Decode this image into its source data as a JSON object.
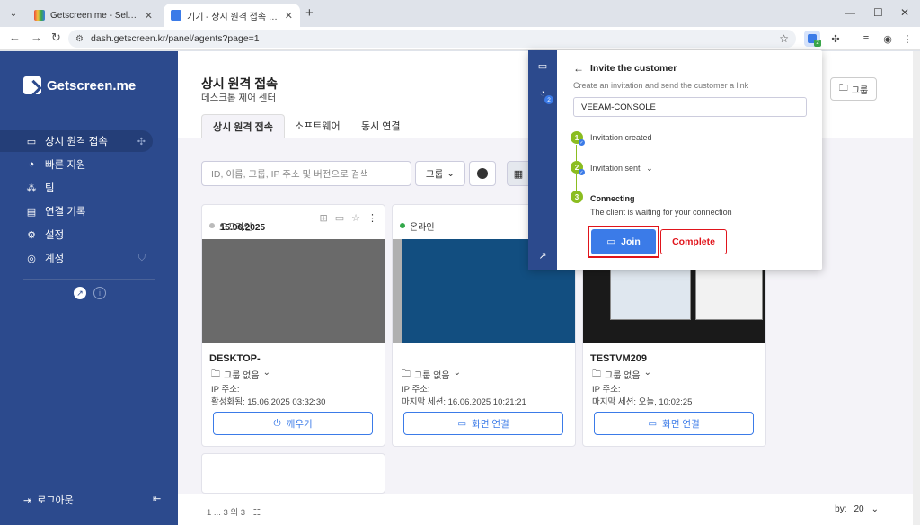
{
  "browser": {
    "tabs": [
      {
        "title": "Getscreen.me - Self-Hosted - G",
        "active": false
      },
      {
        "title": "기기 - 상시 원격 접속 - Getscre",
        "active": true
      }
    ],
    "new_tab": "+",
    "url": "dash.getscreen.kr/panel/agents?page=1"
  },
  "sidebar": {
    "logo_text": "Getscreen.me",
    "items": [
      {
        "label": "상시 원격 접속",
        "icon": "devices-icon"
      },
      {
        "label": "빠른 지원",
        "icon": "speedometer-icon"
      },
      {
        "label": "팀",
        "icon": "team-icon"
      },
      {
        "label": "연결 기록",
        "icon": "calendar-icon"
      },
      {
        "label": "설정",
        "icon": "gear-icon"
      },
      {
        "label": "계정",
        "icon": "account-icon"
      }
    ],
    "logout": "로그아웃"
  },
  "main": {
    "title": "상시 원격 접속",
    "subtitle": "데스크톱 제어 센터",
    "tabs": [
      "상시 원격 접속",
      "소프트웨어",
      "동시 연결"
    ],
    "group_button": "그룹",
    "search_placeholder": "ID, 이름, 그룹, IP 주소 및 버전으로 검색",
    "group_dropdown": "그룹"
  },
  "cards": [
    {
      "status": "오프라인",
      "status_color": "#bbbbbb",
      "date": "15.06.2025",
      "name": "DESKTOP-",
      "group": "그룹 없음",
      "ip_label": "IP 주소:",
      "line2": "활성화됨: 15.06.2025 03:32:30",
      "button": "깨우기",
      "button_icon": "power-icon"
    },
    {
      "status": "온라인",
      "status_color": "#33a84a",
      "date": "",
      "name": "",
      "group": "그룹 없음",
      "ip_label": "IP 주소:",
      "line2": "마지막 세션: 16.06.2025 10:21:21",
      "button": "화면 연결",
      "button_icon": "screen-icon"
    },
    {
      "status": "",
      "status_color": "#33a84a",
      "date": "",
      "name": "TESTVM209",
      "group": "그룹 없음",
      "ip_label": "IP 주소:",
      "line2": "마지막 세션: 오늘, 10:02:25",
      "button": "화면 연결",
      "button_icon": "screen-icon"
    }
  ],
  "footer": {
    "pager": "1 ... 3 의 3",
    "per_page_label": "by:",
    "per_page_value": "20"
  },
  "popup": {
    "title": "Invite the customer",
    "description": "Create an invitation and send the customer a link",
    "input_value": "VEEAM-CONSOLE",
    "rail_badge": "2",
    "steps": [
      {
        "num": "1",
        "label": "Invitation created"
      },
      {
        "num": "2",
        "label": "Invitation sent"
      },
      {
        "num": "3",
        "label": "Connecting",
        "sub": "The client is waiting for your connection"
      }
    ],
    "join_label": "Join",
    "complete_label": "Complete",
    "highlight_color": "#e0141b"
  }
}
